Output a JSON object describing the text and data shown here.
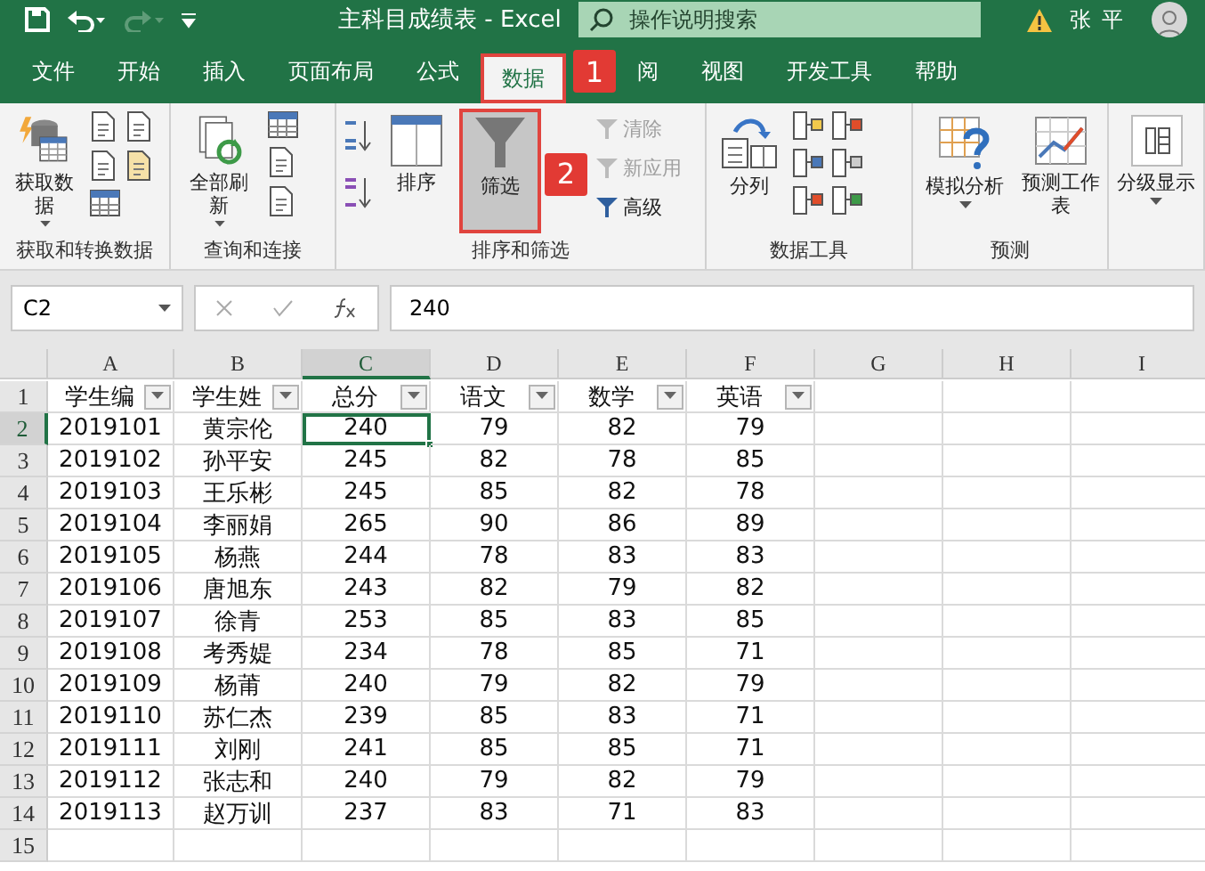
{
  "title_bar": {
    "title": "主科目成绩表  -  Excel",
    "search": {
      "placeholder": "操作说明搜索"
    },
    "user": "张平"
  },
  "tabs": [
    {
      "label": "文件",
      "selected": false
    },
    {
      "label": "开始",
      "selected": false
    },
    {
      "label": "插入",
      "selected": false
    },
    {
      "label": "页面布局",
      "selected": false
    },
    {
      "label": "公式",
      "selected": false
    },
    {
      "label": "数据",
      "selected": true,
      "highlighted": true,
      "callout": "1"
    },
    {
      "label": "阅",
      "selected": false
    },
    {
      "label": "视图",
      "selected": false
    },
    {
      "label": "开发工具",
      "selected": false
    },
    {
      "label": "帮助",
      "selected": false
    }
  ],
  "ribbon": [
    {
      "kind": "get_data",
      "label": "获取和转换数据",
      "buttons": [
        {
          "kind": "large",
          "label": "获取数据",
          "dropdown": true
        }
      ]
    },
    {
      "kind": "queries",
      "label": "查询和连接",
      "buttons": [
        {
          "kind": "large",
          "label": "全部刷新",
          "dropdown": true
        }
      ]
    },
    {
      "kind": "sort_filter",
      "label": "排序和筛选",
      "buttons": [
        {
          "kind": "large",
          "label": "排序"
        },
        {
          "kind": "large",
          "label": "筛选",
          "on": true,
          "highlighted": true,
          "callout": "2"
        },
        {
          "kind": "small",
          "label": "清除",
          "disabled": true
        },
        {
          "kind": "small",
          "label": "新应用",
          "disabled": true
        },
        {
          "kind": "small",
          "label": "高级",
          "disabled": false
        }
      ]
    },
    {
      "kind": "data_tools",
      "label": "数据工具",
      "buttons": [
        {
          "kind": "large",
          "label": "分列"
        }
      ]
    },
    {
      "kind": "forecast",
      "label": "预测",
      "buttons": [
        {
          "kind": "large",
          "label": "模拟分析",
          "dropdown": true
        },
        {
          "kind": "large",
          "label": "预测工作表"
        }
      ]
    },
    {
      "kind": "outline",
      "buttons": [
        {
          "kind": "large",
          "label": "分级显示",
          "dropdown": true
        }
      ]
    }
  ],
  "formula_bar": {
    "name_box": "C2",
    "value": "240"
  },
  "sheet": {
    "columns": [
      {
        "label": "A",
        "selected": false
      },
      {
        "label": "B",
        "selected": false
      },
      {
        "label": "C",
        "selected": true
      },
      {
        "label": "D",
        "selected": false
      },
      {
        "label": "E",
        "selected": false
      },
      {
        "label": "F",
        "selected": false
      },
      {
        "label": "G",
        "selected": false
      },
      {
        "label": "H",
        "selected": false
      },
      {
        "label": "I",
        "selected": false
      }
    ],
    "header": {
      "number": "1",
      "selected": false,
      "cells": [
        "学生编",
        "学生姓",
        "总分",
        "语文",
        "数学",
        "英语"
      ]
    },
    "rows": [
      {
        "number": "2",
        "selected": true,
        "cells": [
          "2019101",
          "黄宗伦",
          "240",
          "79",
          "82",
          "79"
        ]
      },
      {
        "number": "3",
        "selected": false,
        "cells": [
          "2019102",
          "孙平安",
          "245",
          "82",
          "78",
          "85"
        ]
      },
      {
        "number": "4",
        "selected": false,
        "cells": [
          "2019103",
          "王乐彬",
          "245",
          "85",
          "82",
          "78"
        ]
      },
      {
        "number": "5",
        "selected": false,
        "cells": [
          "2019104",
          "李丽娟",
          "265",
          "90",
          "86",
          "89"
        ]
      },
      {
        "number": "6",
        "selected": false,
        "cells": [
          "2019105",
          "杨燕",
          "244",
          "78",
          "83",
          "83"
        ]
      },
      {
        "number": "7",
        "selected": false,
        "cells": [
          "2019106",
          "唐旭东",
          "243",
          "82",
          "79",
          "82"
        ]
      },
      {
        "number": "8",
        "selected": false,
        "cells": [
          "2019107",
          "徐青",
          "253",
          "85",
          "83",
          "85"
        ]
      },
      {
        "number": "9",
        "selected": false,
        "cells": [
          "2019108",
          "考秀媞",
          "234",
          "78",
          "85",
          "71"
        ]
      },
      {
        "number": "10",
        "selected": false,
        "cells": [
          "2019109",
          "杨莆",
          "240",
          "79",
          "82",
          "79"
        ]
      },
      {
        "number": "11",
        "selected": false,
        "cells": [
          "2019110",
          "苏仁杰",
          "239",
          "85",
          "83",
          "71"
        ]
      },
      {
        "number": "12",
        "selected": false,
        "cells": [
          "2019111",
          "刘刚",
          "241",
          "85",
          "85",
          "71"
        ]
      },
      {
        "number": "13",
        "selected": false,
        "cells": [
          "2019112",
          "张志和",
          "240",
          "79",
          "82",
          "79"
        ]
      },
      {
        "number": "14",
        "selected": false,
        "cells": [
          "2019113",
          "赵万训",
          "237",
          "83",
          "71",
          "83"
        ]
      },
      {
        "number": "15",
        "selected": false,
        "cells": []
      }
    ]
  }
}
